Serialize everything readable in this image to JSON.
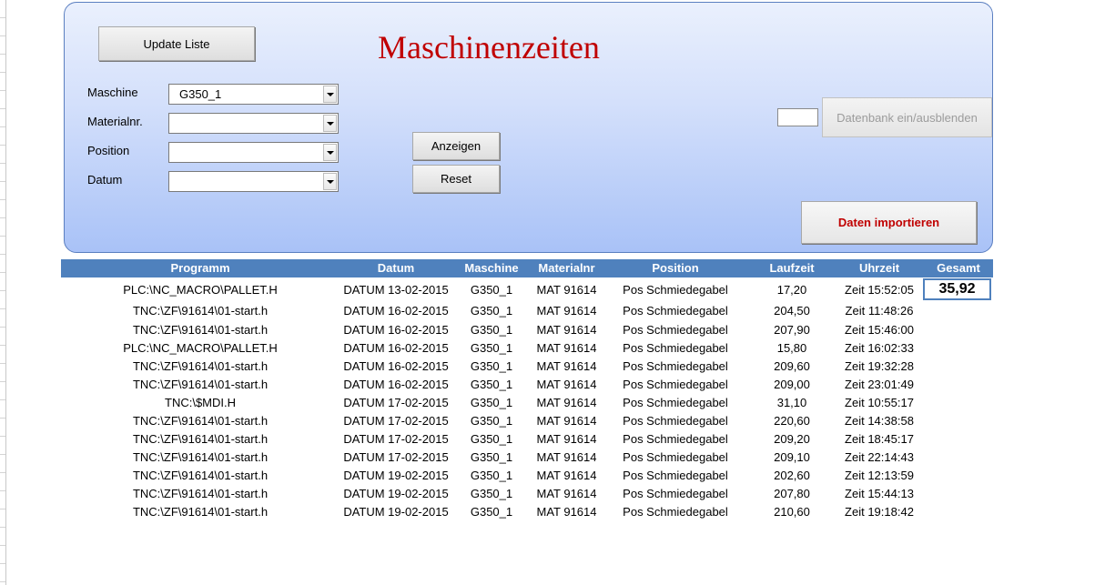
{
  "panel": {
    "title": "Maschinenzeiten",
    "update_button": "Update Liste",
    "show_button": "Anzeigen",
    "reset_button": "Reset",
    "db_toggle_button": "Datenbank ein/ausblenden",
    "import_button": "Daten importieren",
    "small_input_value": "",
    "filters": [
      {
        "label": "Maschine",
        "value": "G350_1"
      },
      {
        "label": "Materialnr.",
        "value": ""
      },
      {
        "label": "Position",
        "value": ""
      },
      {
        "label": "Datum",
        "value": ""
      }
    ]
  },
  "table": {
    "headers": [
      "Programm",
      "Datum",
      "Maschine",
      "Materialnr",
      "Position",
      "Laufzeit",
      "Uhrzeit",
      "Gesamt"
    ],
    "total": "35,92",
    "rows": [
      [
        "PLC:\\NC_MACRO\\PALLET.H",
        "DATUM 13-02-2015",
        "G350_1",
        "MAT 91614",
        "Pos Schmiedegabel",
        "17,20",
        "Zeit 15:52:05"
      ],
      [
        "TNC:\\ZF\\91614\\01-start.h",
        "DATUM 16-02-2015",
        "G350_1",
        "MAT 91614",
        "Pos Schmiedegabel",
        "204,50",
        "Zeit 11:48:26"
      ],
      [
        "TNC:\\ZF\\91614\\01-start.h",
        "DATUM 16-02-2015",
        "G350_1",
        "MAT 91614",
        "Pos Schmiedegabel",
        "207,90",
        "Zeit 15:46:00"
      ],
      [
        "PLC:\\NC_MACRO\\PALLET.H",
        "DATUM 16-02-2015",
        "G350_1",
        "MAT 91614",
        "Pos Schmiedegabel",
        "15,80",
        "Zeit 16:02:33"
      ],
      [
        "TNC:\\ZF\\91614\\01-start.h",
        "DATUM 16-02-2015",
        "G350_1",
        "MAT 91614",
        "Pos Schmiedegabel",
        "209,60",
        "Zeit 19:32:28"
      ],
      [
        "TNC:\\ZF\\91614\\01-start.h",
        "DATUM 16-02-2015",
        "G350_1",
        "MAT 91614",
        "Pos Schmiedegabel",
        "209,00",
        "Zeit 23:01:49"
      ],
      [
        "TNC:\\$MDI.H",
        "DATUM 17-02-2015",
        "G350_1",
        "MAT 91614",
        "Pos Schmiedegabel",
        "31,10",
        "Zeit 10:55:17"
      ],
      [
        "TNC:\\ZF\\91614\\01-start.h",
        "DATUM 17-02-2015",
        "G350_1",
        "MAT 91614",
        "Pos Schmiedegabel",
        "220,60",
        "Zeit 14:38:58"
      ],
      [
        "TNC:\\ZF\\91614\\01-start.h",
        "DATUM 17-02-2015",
        "G350_1",
        "MAT 91614",
        "Pos Schmiedegabel",
        "209,20",
        "Zeit 18:45:17"
      ],
      [
        "TNC:\\ZF\\91614\\01-start.h",
        "DATUM 17-02-2015",
        "G350_1",
        "MAT 91614",
        "Pos Schmiedegabel",
        "209,10",
        "Zeit 22:14:43"
      ],
      [
        "TNC:\\ZF\\91614\\01-start.h",
        "DATUM 19-02-2015",
        "G350_1",
        "MAT 91614",
        "Pos Schmiedegabel",
        "202,60",
        "Zeit 12:13:59"
      ],
      [
        "TNC:\\ZF\\91614\\01-start.h",
        "DATUM 19-02-2015",
        "G350_1",
        "MAT 91614",
        "Pos Schmiedegabel",
        "207,80",
        "Zeit 15:44:13"
      ],
      [
        "TNC:\\ZF\\91614\\01-start.h",
        "DATUM 19-02-2015",
        "G350_1",
        "MAT 91614",
        "Pos Schmiedegabel",
        "210,60",
        "Zeit 19:18:42"
      ]
    ]
  }
}
